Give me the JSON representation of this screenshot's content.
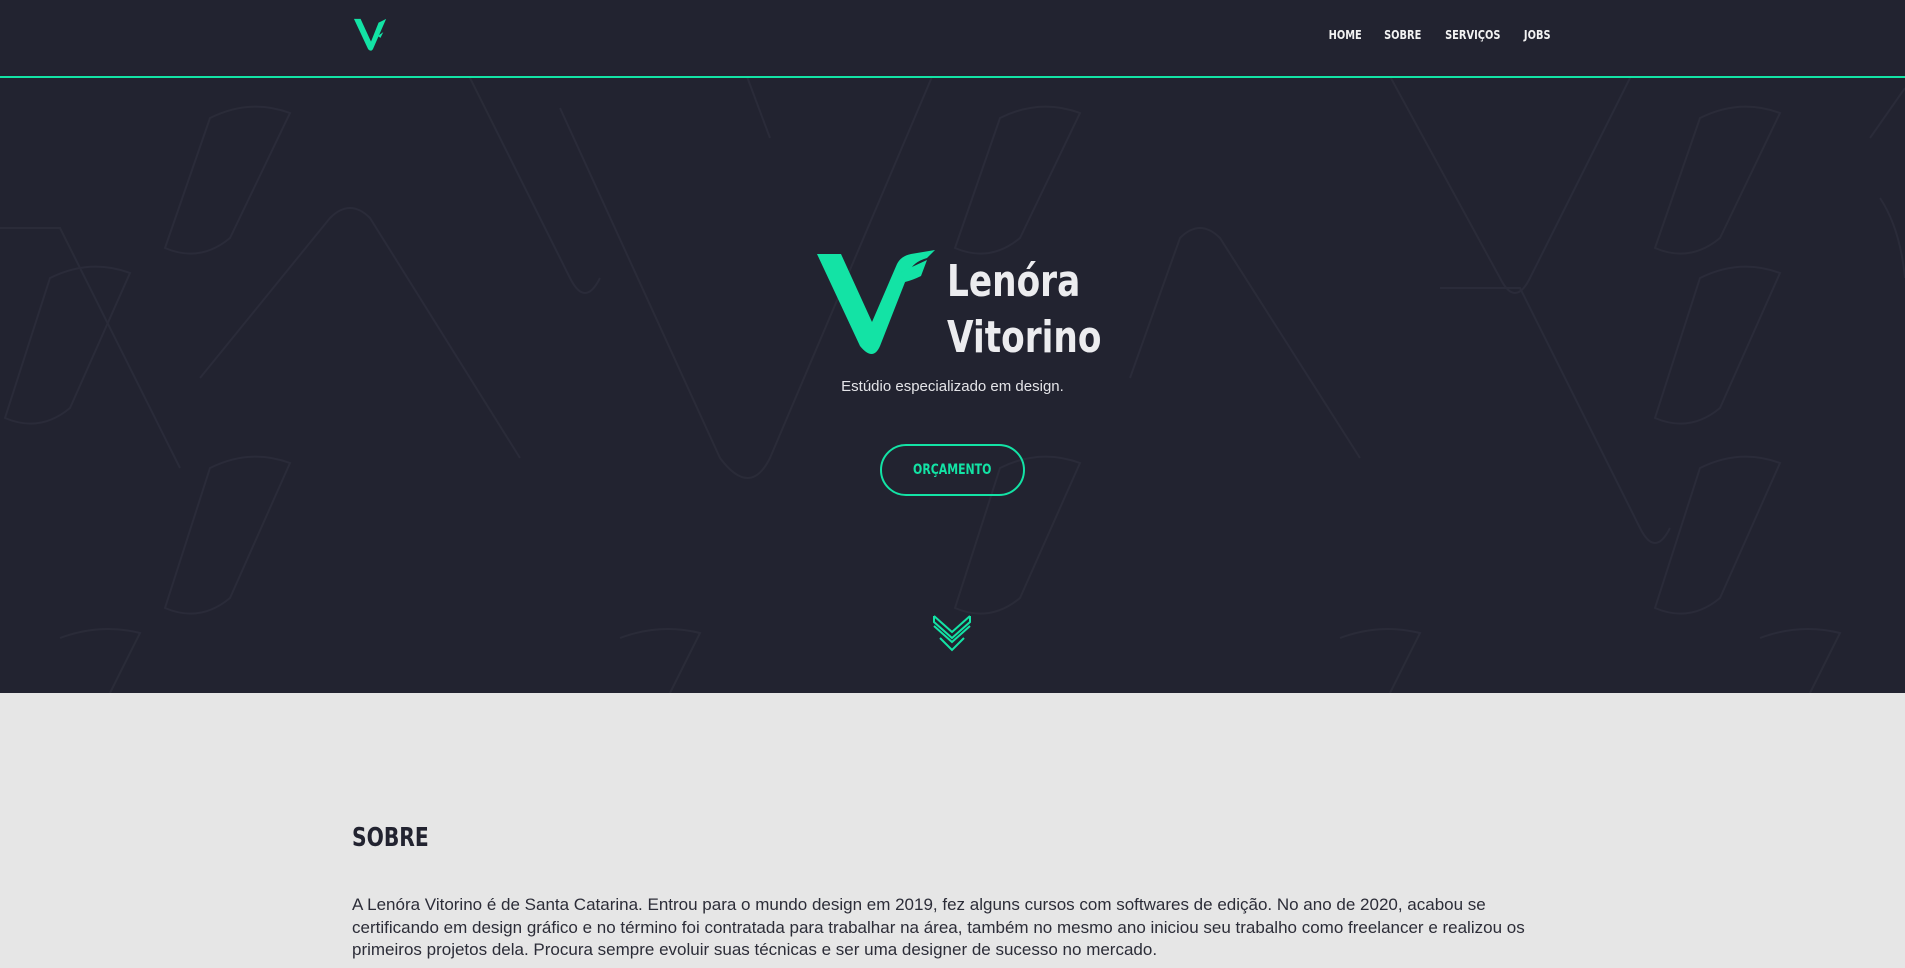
{
  "header": {
    "logo": "v-logo-icon",
    "nav": [
      "HOME",
      "SOBRE",
      "SERVIÇOS",
      "JOBS"
    ]
  },
  "hero": {
    "name_line1": "Lenóra",
    "name_line2": "Vitorino",
    "tagline": "Estúdio especializado em design.",
    "cta_label": "ORÇAMENTO",
    "scroll_icon": "double-chevron-down-icon"
  },
  "about": {
    "title": "SOBRE",
    "text": "A Lenóra Vitorino é de Santa Catarina. Entrou para o mundo design em 2019, fez alguns cursos com softwares de edição. No ano de 2020, acabou se certificando em design gráfico e no término foi contratada para trabalhar na área, também no mesmo ano iniciou seu trabalho como freelancer e realizou os primeiros projetos dela. Procura sempre evoluir suas técnicas e ser uma designer de sucesso no mercado."
  },
  "colors": {
    "accent": "#13e3a5",
    "dark": "#222330",
    "light": "#e6e6e6"
  }
}
